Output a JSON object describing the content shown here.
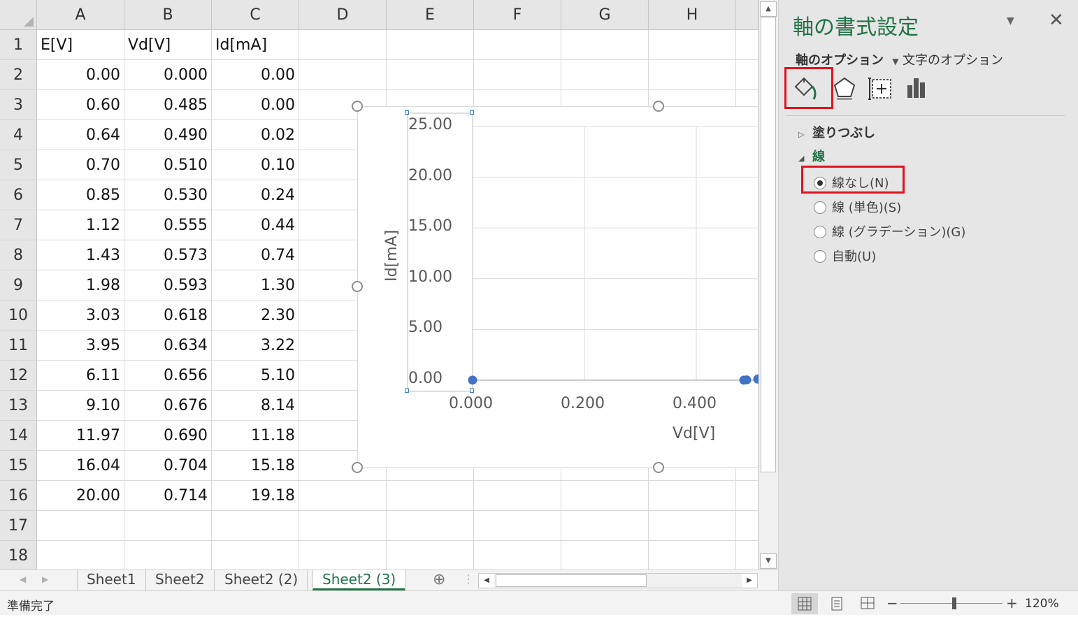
{
  "sheet": {
    "columns": [
      "A",
      "B",
      "C",
      "D",
      "E",
      "F",
      "G",
      "H"
    ],
    "rows": [
      "1",
      "2",
      "3",
      "4",
      "5",
      "6",
      "7",
      "8",
      "9",
      "10",
      "11",
      "12",
      "13",
      "14",
      "15",
      "16",
      "17",
      "18"
    ],
    "header_row": [
      "E[V]",
      "Vd[V]",
      "Id[mA]"
    ],
    "data": [
      [
        "0.00",
        "0.000",
        "0.00"
      ],
      [
        "0.60",
        "0.485",
        "0.00"
      ],
      [
        "0.64",
        "0.490",
        "0.02"
      ],
      [
        "0.70",
        "0.510",
        "0.10"
      ],
      [
        "0.85",
        "0.530",
        "0.24"
      ],
      [
        "1.12",
        "0.555",
        "0.44"
      ],
      [
        "1.43",
        "0.573",
        "0.74"
      ],
      [
        "1.98",
        "0.593",
        "1.30"
      ],
      [
        "3.03",
        "0.618",
        "2.30"
      ],
      [
        "3.95",
        "0.634",
        "3.22"
      ],
      [
        "6.11",
        "0.656",
        "5.10"
      ],
      [
        "9.10",
        "0.676",
        "8.14"
      ],
      [
        "11.97",
        "0.690",
        "11.18"
      ],
      [
        "16.04",
        "0.704",
        "15.18"
      ],
      [
        "20.00",
        "0.714",
        "19.18"
      ]
    ]
  },
  "chart_data": {
    "type": "scatter",
    "xlabel": "Vd[V]",
    "ylabel": "Id[mA]",
    "xlim": [
      0,
      0.5
    ],
    "ylim": [
      0,
      25
    ],
    "x_ticks": [
      "0.000",
      "0.200",
      "0.400"
    ],
    "y_ticks": [
      "0.00",
      "5.00",
      "10.00",
      "15.00",
      "20.00",
      "25.00"
    ],
    "grid": true,
    "marker_color": "#4472c4",
    "points": [
      {
        "x": 0.0,
        "y": 0.0
      },
      {
        "x": 0.485,
        "y": 0.0
      },
      {
        "x": 0.49,
        "y": 0.02
      },
      {
        "x": 0.51,
        "y": 0.1
      }
    ]
  },
  "tabs": {
    "sheets": [
      "Sheet1",
      "Sheet2",
      "Sheet2 (2)",
      "Sheet2 (3)"
    ],
    "active": "Sheet2 (3)",
    "add_symbol": "⊕"
  },
  "pane": {
    "title": "軸の書式設定",
    "subtab_axis": "軸のオプション",
    "subtab_text": "文字のオプション",
    "section_fill": "塗りつぶし",
    "section_line": "線",
    "options": [
      "線なし(N)",
      "線 (単色)(S)",
      "線 (グラデーション)(G)",
      "自動(U)"
    ],
    "selected_option": 0,
    "accent_color": "#217346"
  },
  "status": {
    "ready": "準備完了",
    "zoom": "120%"
  }
}
